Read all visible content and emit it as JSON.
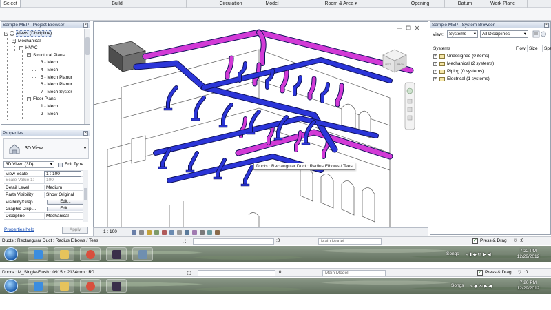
{
  "ribbon": {
    "tabs": [
      "Select",
      "Build",
      "Circulation",
      "Model",
      "Room & Area ▾",
      "Opening",
      "Datum",
      "Work Plane"
    ]
  },
  "project_browser": {
    "title": "Sample MEP - Project Browser",
    "items": [
      {
        "label": "Views (Discipline)",
        "level": 0,
        "selected": true
      },
      {
        "label": "Mechanical",
        "level": 1
      },
      {
        "label": "HVAC",
        "level": 2
      },
      {
        "label": "Structural Plans",
        "level": 3
      },
      {
        "label": "3 - Mech",
        "level": 4
      },
      {
        "label": "4 - Mech",
        "level": 4
      },
      {
        "label": "5 - Mech Planur",
        "level": 4
      },
      {
        "label": "6 - Mech Planur",
        "level": 4
      },
      {
        "label": "7 - Mech Syster",
        "level": 4
      },
      {
        "label": "Floor Plans",
        "level": 3
      },
      {
        "label": "1 - Mech",
        "level": 4
      },
      {
        "label": "2 - Mech",
        "level": 4
      }
    ]
  },
  "properties": {
    "title": "Properties",
    "type_name": "3D View",
    "selector": "3D View: {3D}",
    "edit_type": "Edit Type",
    "rows": [
      {
        "key": "View Scale",
        "value": "1 : 100",
        "disabled": false
      },
      {
        "key": "Scale Value  1:",
        "value": "100",
        "disabled": true
      },
      {
        "key": "Detail Level",
        "value": "Medium",
        "disabled": false
      },
      {
        "key": "Parts Visibility",
        "value": "Show Original",
        "disabled": false
      },
      {
        "key": "Visibility/Grap...",
        "value": "Edit...",
        "button": true
      },
      {
        "key": "Graphic Displ...",
        "value": "Edit...",
        "button": true
      },
      {
        "key": "Discipline",
        "value": "Mechanical",
        "disabled": false
      }
    ],
    "help": "Properties help",
    "apply": "Apply"
  },
  "system_browser": {
    "title": "Sample MEP - System Browser",
    "view_label": "View:",
    "view_value": "Systems",
    "discipline_value": "All Disciplines",
    "columns": [
      "Systems",
      "Flow",
      "Size",
      "Spa"
    ],
    "rows": [
      {
        "label": "Unassigned (0 items)"
      },
      {
        "label": "Mechanical (2 systems)"
      },
      {
        "label": "Piping (0 systems)"
      },
      {
        "label": "Electrical (1 systems)"
      }
    ]
  },
  "viewport": {
    "scale": "1 : 100",
    "tooltip": "Ducts : Rectangular Duct : Radius Elbows / Tees",
    "cube_labels": [
      "LEFT",
      "BACK"
    ],
    "supply_color": "#2b35d8",
    "return_color": "#d23ad6",
    "unit_color": "#5a5a5a"
  },
  "status1": {
    "text": "Ducts : Rectangular Duct : Radius Elbows / Tees",
    "sel_count": ":0",
    "model": "Main Model",
    "press_drag": "Press & Drag",
    "filter": ":0"
  },
  "taskbar1": {
    "songs": "Songs",
    "time": "7:22 PM",
    "date": "12/29/2012"
  },
  "status2": {
    "text": "Doors : M_Single-Flush : 0915 x 2134mm : R0",
    "sel_count": ":0",
    "model": "Main Model",
    "press_drag": "Press & Drag",
    "filter": ":0"
  },
  "taskbar2": {
    "songs": "Songs",
    "time": "7:20 PM",
    "date": "12/29/2012"
  }
}
